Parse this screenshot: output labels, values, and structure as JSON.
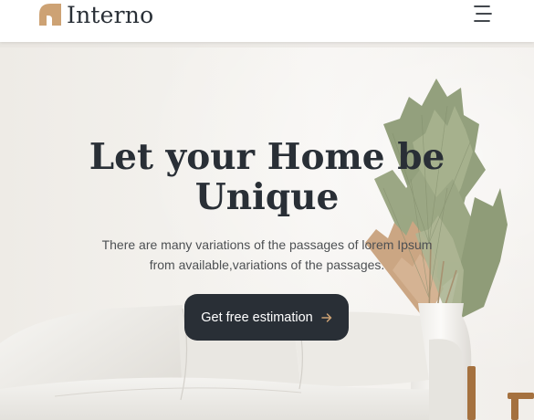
{
  "brand": {
    "name": "Interno",
    "accent_color": "#cda274",
    "dark_color": "#292f36"
  },
  "header": {
    "menu_icon": "hamburger-menu-icon"
  },
  "hero": {
    "title_line1": "Let your Home be",
    "title_line2": "Unique",
    "description_line1": "There are many variations of the passages of lorem Ipsum",
    "description_line2": "from available,variations of the passages.",
    "cta_label": "Get free estimation",
    "cta_icon": "arrow-right-icon",
    "background_image": "living-room-sofa-with-dried-palm-leaves"
  }
}
